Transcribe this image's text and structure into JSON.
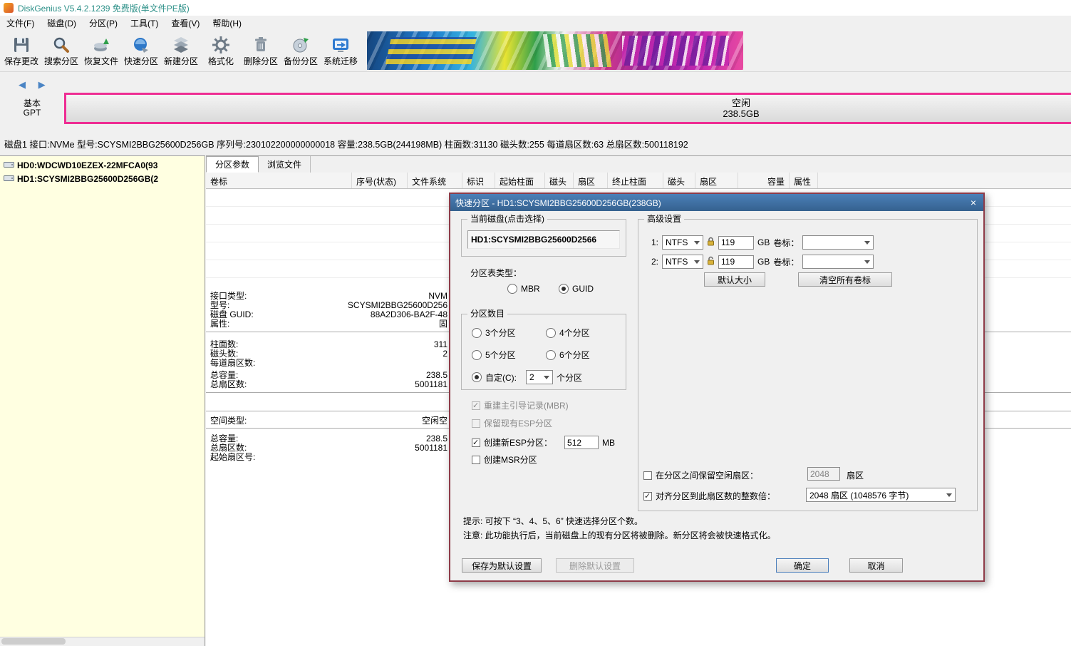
{
  "window": {
    "title": "DiskGenius V5.4.2.1239 免费版(单文件PE版)",
    "menus": [
      "文件(F)",
      "磁盘(D)",
      "分区(P)",
      "工具(T)",
      "查看(V)",
      "帮助(H)"
    ]
  },
  "toolbar": {
    "items": [
      {
        "label": "保存更改",
        "icon": "save-icon"
      },
      {
        "label": "搜索分区",
        "icon": "search-icon"
      },
      {
        "label": "恢复文件",
        "icon": "recover-icon"
      },
      {
        "label": "快速分区",
        "icon": "quick-partition-icon"
      },
      {
        "label": "新建分区",
        "icon": "new-partition-icon"
      },
      {
        "label": "格式化",
        "icon": "format-icon"
      },
      {
        "label": "删除分区",
        "icon": "trash-icon"
      },
      {
        "label": "备份分区",
        "icon": "backup-icon"
      },
      {
        "label": "系统迁移",
        "icon": "migrate-icon"
      }
    ]
  },
  "disk_bar": {
    "nav_arrows": "◀ ▶",
    "bus": "基本",
    "table_type": "GPT",
    "free_label": "空闲",
    "free_size": "238.5GB",
    "border_color": "#EE2D93"
  },
  "disk_info": "磁盘1 接口:NVMe 型号:SCYSMI2BBG25600D256GB 序列号:230102200000000018 容量:238.5GB(244198MB) 柱面数:31130 磁头数:255 每道扇区数:63 总扇区数:500118192",
  "tree": {
    "items": [
      "HD0:WDCWD10EZEX-22MFCA0(93",
      "HD1:SCYSMI2BBG25600D256GB(2"
    ]
  },
  "main": {
    "tabs": [
      "分区参数",
      "浏览文件"
    ],
    "table_headers": [
      "卷标",
      "序号(状态)",
      "文件系统",
      "标识",
      "起始柱面",
      "磁头",
      "扇区",
      "终止柱面",
      "磁头",
      "扇区",
      "容量",
      "属性"
    ],
    "details": {
      "s1": [
        {
          "l": "接口类型:",
          "v": "NVM"
        },
        {
          "l": "型号:",
          "v": "SCYSMI2BBG25600D256"
        },
        {
          "l": "磁盘 GUID:",
          "v": "88A2D306-BA2F-48"
        },
        {
          "l": "属性:",
          "v": "固"
        }
      ],
      "s2": [
        {
          "l": "柱面数:",
          "v": "311"
        },
        {
          "l": "磁头数:",
          "v": "2"
        },
        {
          "l": "每道扇区数:",
          "v": ""
        },
        {
          "l": "总容量:",
          "v": "238.5"
        },
        {
          "l": "总扇区数:",
          "v": "5001181"
        }
      ],
      "s3": [
        {
          "l": "空间类型:",
          "v": "空闲空"
        }
      ],
      "s4": [
        {
          "l": "总容量:",
          "v": "238.5"
        },
        {
          "l": "总扇区数:",
          "v": "5001181"
        },
        {
          "l": "起始扇区号:",
          "v": ""
        }
      ]
    }
  },
  "dialog": {
    "title": "快速分区 - HD1:SCYSMI2BBG25600D256GB(238GB)",
    "close": "×",
    "current_disk_group": "当前磁盘(点击选择)",
    "current_disk": "HD1:SCYSMI2BBG25600D2566",
    "table_type_label": "分区表类型：",
    "radio_mbr": "MBR",
    "radio_guid": "GUID",
    "count_group": "分区数目",
    "count_3": "3个分区",
    "count_4": "4个分区",
    "count_5": "5个分区",
    "count_6": "6个分区",
    "custom_label": "自定(C):",
    "custom_value": "2",
    "custom_suffix": "个分区",
    "chk_rebuild_mbr": "重建主引导记录(MBR)",
    "chk_keep_esp": "保留现有ESP分区",
    "chk_create_esp": "创建新ESP分区：",
    "esp_size": "512",
    "esp_unit": "MB",
    "chk_create_msr": "创建MSR分区",
    "adv": {
      "group": "高级设置",
      "rows": [
        {
          "index": "1:",
          "fs": "NTFS",
          "size": "119",
          "unit": "GB",
          "vol_label": "卷标："
        },
        {
          "index": "2:",
          "fs": "NTFS",
          "size": "119",
          "unit": "GB",
          "vol_label": "卷标："
        }
      ],
      "btn_default_size": "默认大小",
      "btn_clear_labels": "清空所有卷标",
      "chk_reserve": "在分区之间保留空闲扇区：",
      "reserve_value": "2048",
      "reserve_unit": "扇区",
      "chk_align": "对齐分区到此扇区数的整数倍：",
      "align_value": "2048 扇区 (1048576 字节)"
    },
    "hint": "提示: 可按下 “3、4、5、6” 快速选择分区个数。",
    "note": "注意: 此功能执行后，当前磁盘上的现有分区将被删除。新分区将会被快速格式化。",
    "btn_save_default": "保存为默认设置",
    "btn_delete_default": "删除默认设置",
    "btn_ok": "确定",
    "btn_cancel": "取消"
  }
}
